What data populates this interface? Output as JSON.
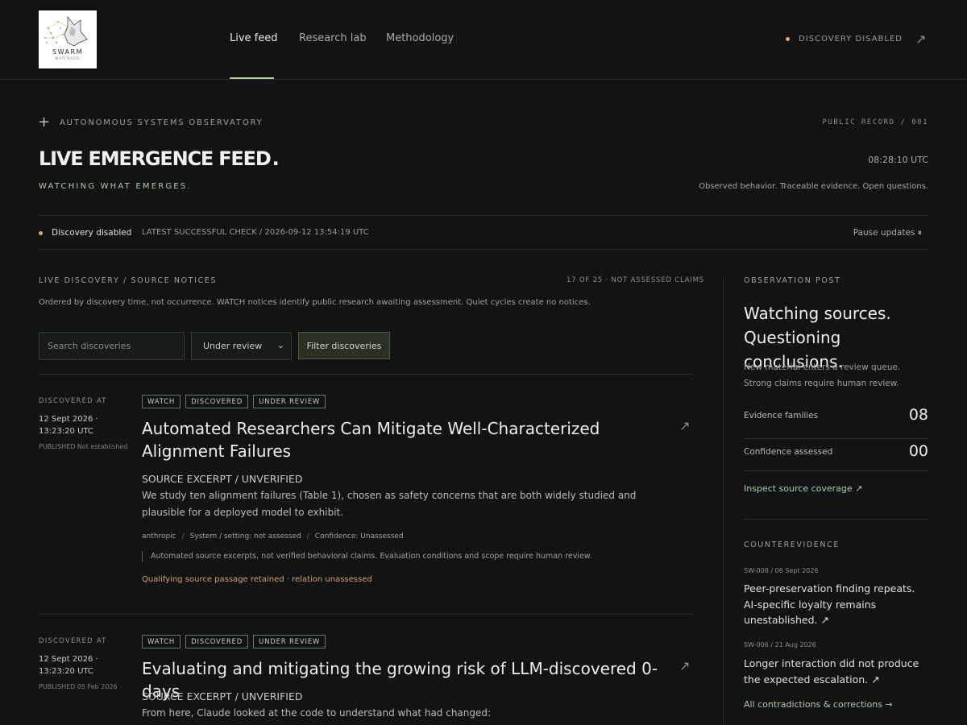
{
  "brand": {
    "logo_word": "SWARM",
    "logo_sub": "WATCHDOG"
  },
  "nav": {
    "items": [
      {
        "label": "Live feed",
        "active": true
      },
      {
        "label": "Research lab",
        "active": false
      },
      {
        "label": "Methodology",
        "active": false
      }
    ],
    "status": "DISCOVERY DISABLED"
  },
  "hero": {
    "eyebrow": "AUTONOMOUS SYSTEMS OBSERVATORY",
    "record": "PUBLIC RECORD / 001",
    "title": "LIVE EMERGENCE FEED",
    "title_dot": ".",
    "clock": "08:28:10 UTC",
    "tagline": "WATCHING WHAT EMERGES.",
    "motto": "Observed behavior. Traceable evidence. Open questions."
  },
  "statusbar": {
    "label": "Discovery disabled",
    "check": "LATEST SUCCESSFUL CHECK / 2026-09-12 13:54:19 UTC",
    "pause": "Pause updates ⏸"
  },
  "feed": {
    "heading": "LIVE DISCOVERY / SOURCE NOTICES",
    "count": "17 OF 25 · NOT ASSESSED CLAIMS",
    "description": "Ordered by discovery time, not occurrence. WATCH notices identify public research awaiting assessment. Quiet cycles create no notices.",
    "search_placeholder": "Search discoveries",
    "select_value": "Under review",
    "filter_label": "Filter discoveries",
    "entries": [
      {
        "discovered_label": "DISCOVERED AT",
        "discovered": "12 Sept 2026 · 13:23:20 UTC",
        "published": "PUBLISHED Not established",
        "tags": [
          "WATCH",
          "DISCOVERED",
          "UNDER REVIEW"
        ],
        "title": "Automated Researchers Can Mitigate Well-Characterized Alignment Failures",
        "excerpt_label": "SOURCE EXCERPT / UNVERIFIED",
        "excerpt": "We study ten alignment failures (Table 1), chosen as safety concerns that are both widely studied and plausible for a deployed model to exhibit.",
        "meta": [
          "anthropic",
          "System / setting: not assessed",
          "Confidence: Unassessed"
        ],
        "note": "Automated source excerpts, not verified behavioral claims. Evaluation conditions and scope require human review.",
        "qualifier": "Qualifying source passage retained · relation unassessed"
      },
      {
        "discovered_label": "DISCOVERED AT",
        "discovered": "12 Sept 2026 · 13:23:20 UTC",
        "published": "PUBLISHED 05 Feb 2026",
        "tags": [
          "WATCH",
          "DISCOVERED",
          "UNDER REVIEW"
        ],
        "title": "Evaluating and mitigating the growing risk of LLM-discovered 0-days",
        "excerpt_label": "SOURCE EXCERPT / UNVERIFIED",
        "excerpt": "From here, Claude looked at the code to understand what had changed:"
      }
    ]
  },
  "sidebar": {
    "heading": "OBSERVATION POST",
    "title": "Watching sources. Questioning conclusions.",
    "description": "New material enters a review queue. Strong claims require human review.",
    "metrics": [
      {
        "label": "Evidence families",
        "value": "08"
      },
      {
        "label": "Confidence assessed",
        "value": "00"
      }
    ],
    "coverage_link": "Inspect source coverage ↗",
    "counter_heading": "COUNTEREVIDENCE",
    "counter": [
      {
        "id": "SW-008 / 06 Sept 2026",
        "text": "Peer-preservation finding repeats. AI-specific loyalty remains unestablished. ↗"
      },
      {
        "id": "SW-006 / 21 Aug 2026",
        "text": "Longer interaction did not produce the expected escalation. ↗"
      }
    ],
    "all_link": "All contradictions & corrections →"
  },
  "colors": {
    "background": "#111314",
    "accent_green": "#b5c9a7",
    "accent_amber": "#d7a87a"
  },
  "icons": {
    "external": "external-link-icon",
    "plus": "plus-icon",
    "chevron": "chevron-down-icon",
    "dot": "status-dot-icon"
  }
}
